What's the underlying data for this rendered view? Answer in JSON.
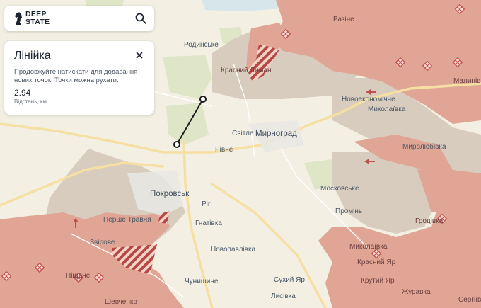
{
  "app": {
    "logo_line1": "DEEP",
    "logo_line2": "STATE"
  },
  "ruler_panel": {
    "title": "Лінійка",
    "description": "Продовжуйте натискати для додавання нових точок. Точки можна рухати.",
    "distance_value": "2.94",
    "distance_unit": "Відстань, км"
  },
  "icons": {
    "search": "search-icon",
    "close": "close-icon",
    "logo": "chess-knight-icon",
    "marker": "diamond-marker-icon",
    "arrow": "advance-arrow-icon"
  },
  "colors": {
    "occupied": "#e0a594",
    "contested": "#d7ccbd",
    "background": "#f3f0e3",
    "road": "#f4dfa0",
    "hatch": "#b54a44",
    "marker": "#c0504d"
  },
  "places": {
    "rodynske": "Родинське",
    "krasnyi_lyman": "Красний Лиман",
    "razine": "Разіне",
    "malynivka": "Малинівка",
    "novoekonomichne": "Новоекономічне",
    "mykolaivka_n": "Миколаївка",
    "svitle": "Світле",
    "myrnohrad": "Мирноград",
    "rivne": "Рівне",
    "myroliubivka": "Миролюбівка",
    "pokrovsk": "Покровськ",
    "rih": "Ріг",
    "moskovske": "Московське",
    "promin": "Промінь",
    "hrodivka": "Гродівка",
    "pershe_travnia": "Перше Травня",
    "hnativka": "Гнатівка",
    "zvirove": "Звірове",
    "novopavlivka": "Новопавлівка",
    "mykolaivka_s": "Миколаївка",
    "krasnyi_yar": "Красний Яр",
    "krutyi_yar": "Крутий Яр",
    "pishchane": "Піщане",
    "chunyshyne": "Чунишине",
    "sukhyi_yar": "Сухий Яр",
    "lysivka": "Лисівка",
    "zhuravka": "Журавка",
    "shevchenko": "Шевченко",
    "serhiivka": "Сергіївка"
  }
}
